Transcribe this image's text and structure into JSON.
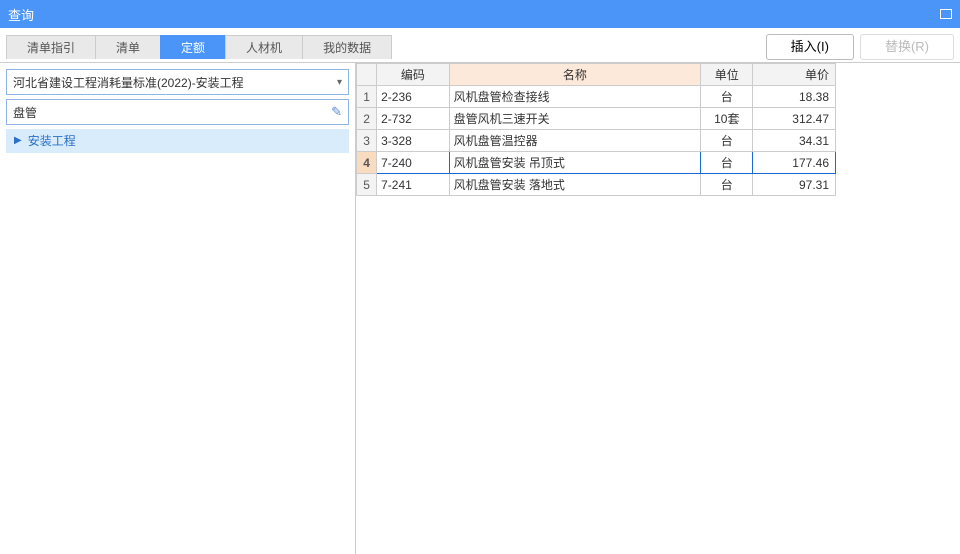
{
  "title": "查询",
  "tabs": [
    "清单指引",
    "清单",
    "定额",
    "人材机",
    "我的数据"
  ],
  "active_tab": 2,
  "buttons": {
    "insert": "插入(I)",
    "replace": "替换(R)"
  },
  "left": {
    "standard": "河北省建设工程消耗量标准(2022)-安装工程",
    "search": "盘管",
    "tree_item": "安装工程"
  },
  "table": {
    "headers": {
      "code": "编码",
      "name": "名称",
      "unit": "单位",
      "price": "单价"
    },
    "rows": [
      {
        "n": "1",
        "code": "2-236",
        "name": "风机盘管检查接线",
        "unit": "台",
        "price": "18.38"
      },
      {
        "n": "2",
        "code": "2-732",
        "name": "盘管风机三速开关",
        "unit": "10套",
        "price": "312.47"
      },
      {
        "n": "3",
        "code": "3-328",
        "name": "风机盘管温控器",
        "unit": "台",
        "price": "34.31"
      },
      {
        "n": "4",
        "code": "7-240",
        "name": "风机盘管安装 吊顶式",
        "unit": "台",
        "price": "177.46"
      },
      {
        "n": "5",
        "code": "7-241",
        "name": "风机盘管安装 落地式",
        "unit": "台",
        "price": "97.31"
      }
    ],
    "selected": 3
  }
}
